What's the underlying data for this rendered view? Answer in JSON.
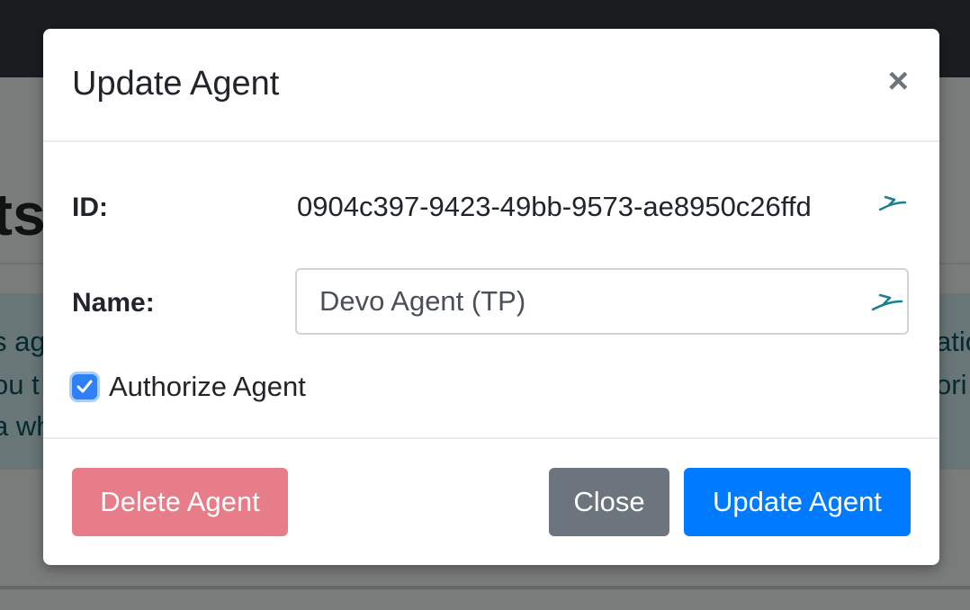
{
  "background": {
    "heading_fragment": "ts",
    "alert_lines": [
      "s age",
      "ou t",
      "a wh"
    ],
    "alert_lines_right": [
      "atio",
      "ori",
      ""
    ]
  },
  "modal": {
    "title": "Update Agent",
    "close_symbol": "×",
    "id_label": "ID:",
    "id_value": "0904c397-9423-49bb-9573-ae8950c26ffd",
    "name_label": "Name:",
    "name_value": "Devo Agent (TP)",
    "authorize_label": "Authorize Agent",
    "authorize_checked": true,
    "buttons": {
      "delete": "Delete Agent",
      "close": "Close",
      "update": "Update Agent"
    }
  },
  "icons": {
    "id_field_icon": "pen-icon",
    "name_field_icon": "pen-icon",
    "close_icon": "close-icon",
    "check_icon": "checkmark-icon"
  },
  "colors": {
    "primary": "#007bff",
    "danger_disabled": "#e77d88",
    "secondary": "#6c757d",
    "navbar": "#343a40",
    "checkbox": "#2f7ff6"
  }
}
